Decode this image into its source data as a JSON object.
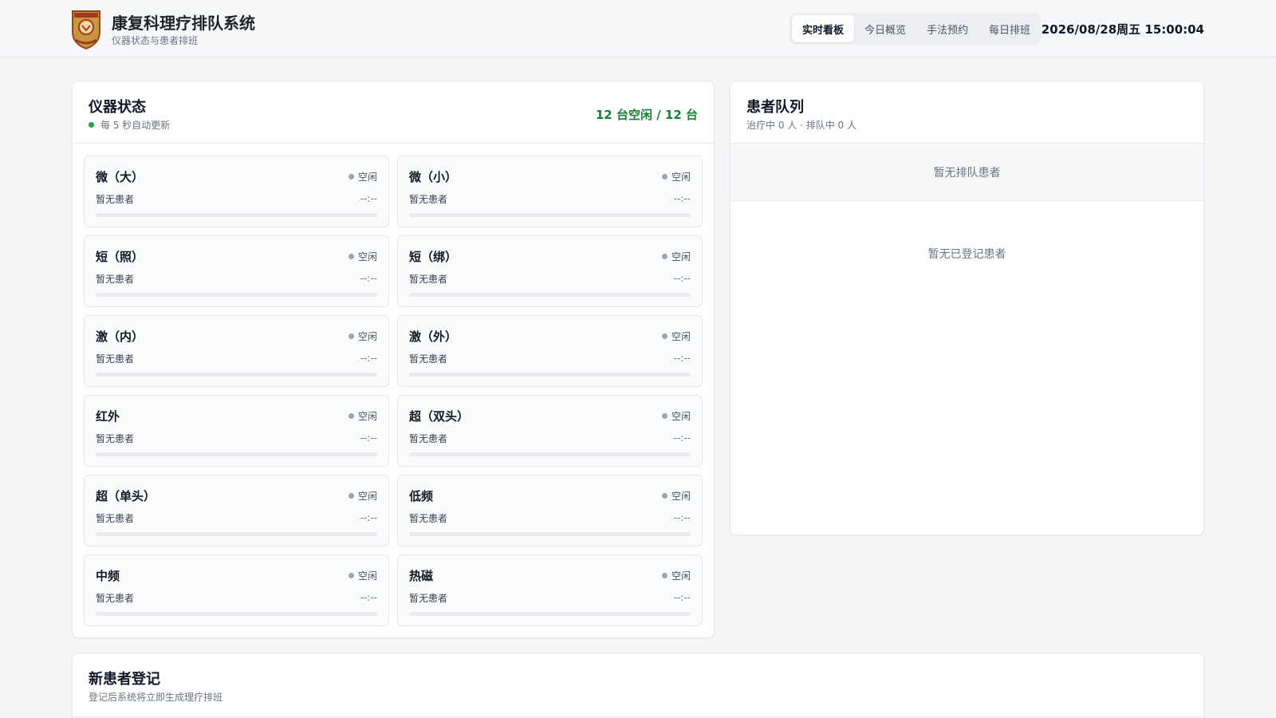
{
  "header": {
    "title": "康复科理疗排队系统",
    "subtitle": "仪器状态与患者排班",
    "logo_icon": "hospital-crest-icon",
    "tabs": [
      {
        "label": "实时看板",
        "active": true
      },
      {
        "label": "今日概览",
        "active": false
      },
      {
        "label": "手法预约",
        "active": false
      },
      {
        "label": "每日排班",
        "active": false
      }
    ],
    "datetime": "2026/08/28周五 15:00:04"
  },
  "devices_panel": {
    "title": "仪器状态",
    "update_note": "每 5 秒自动更新",
    "free_summary": "12 台空闲 / 12 台",
    "accent_color": "#1a7f37",
    "devices": [
      {
        "name": "微（大）",
        "status": "空闲",
        "patient": "暂无患者",
        "time": "--:--",
        "progress": 0
      },
      {
        "name": "微（小）",
        "status": "空闲",
        "patient": "暂无患者",
        "time": "--:--",
        "progress": 0
      },
      {
        "name": "短（照）",
        "status": "空闲",
        "patient": "暂无患者",
        "time": "--:--",
        "progress": 0
      },
      {
        "name": "短（绑）",
        "status": "空闲",
        "patient": "暂无患者",
        "time": "--:--",
        "progress": 0
      },
      {
        "name": "激（内）",
        "status": "空闲",
        "patient": "暂无患者",
        "time": "--:--",
        "progress": 0
      },
      {
        "name": "激（外）",
        "status": "空闲",
        "patient": "暂无患者",
        "time": "--:--",
        "progress": 0
      },
      {
        "name": "红外",
        "status": "空闲",
        "patient": "暂无患者",
        "time": "--:--",
        "progress": 0
      },
      {
        "name": "超（双头）",
        "status": "空闲",
        "patient": "暂无患者",
        "time": "--:--",
        "progress": 0
      },
      {
        "name": "超（单头）",
        "status": "空闲",
        "patient": "暂无患者",
        "time": "--:--",
        "progress": 0
      },
      {
        "name": "低频",
        "status": "空闲",
        "patient": "暂无患者",
        "time": "--:--",
        "progress": 0
      },
      {
        "name": "中频",
        "status": "空闲",
        "patient": "暂无患者",
        "time": "--:--",
        "progress": 0
      },
      {
        "name": "热磁",
        "status": "空闲",
        "patient": "暂无患者",
        "time": "--:--",
        "progress": 0
      }
    ]
  },
  "queue_panel": {
    "title": "患者队列",
    "summary": "治疗中 0 人 · 排队中 0 人",
    "queue_empty": "暂无排队患者",
    "registered_empty": "暂无已登记患者"
  },
  "register_panel": {
    "title": "新患者登记",
    "subtitle": "登记后系统将立即生成理疗排班"
  }
}
